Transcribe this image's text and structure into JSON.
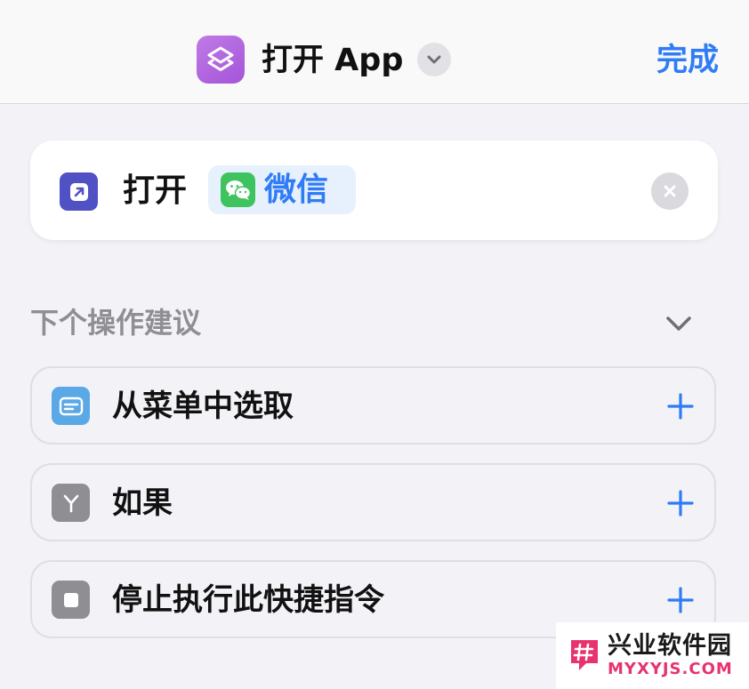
{
  "header": {
    "title": "打开 App",
    "done_label": "完成",
    "app_icon": "shortcuts-layers-icon",
    "dropdown_icon": "chevron-down-icon"
  },
  "action": {
    "verb": "打开",
    "app_name": "微信",
    "app_icon": "wechat-icon",
    "action_icon": "open-app-icon",
    "clear_icon": "close-icon"
  },
  "suggestions": {
    "title": "下个操作建议",
    "toggle_icon": "chevron-down-icon",
    "items": [
      {
        "label": "从菜单中选取",
        "icon": "menu-list-icon",
        "icon_color": "#5aa9e6"
      },
      {
        "label": "如果",
        "icon": "branch-icon",
        "icon_color": "#8e8e93"
      },
      {
        "label": "停止执行此快捷指令",
        "icon": "stop-icon",
        "icon_color": "#8e8e93"
      }
    ],
    "add_icon": "plus-icon"
  },
  "watermark": {
    "name": "兴业软件园",
    "domain": "MYXYJS.COM"
  },
  "colors": {
    "accent": "#2f7cf6",
    "background": "#f2f2f7",
    "wechat_green": "#3fc35f",
    "action_icon_bg": "#5151c6"
  }
}
